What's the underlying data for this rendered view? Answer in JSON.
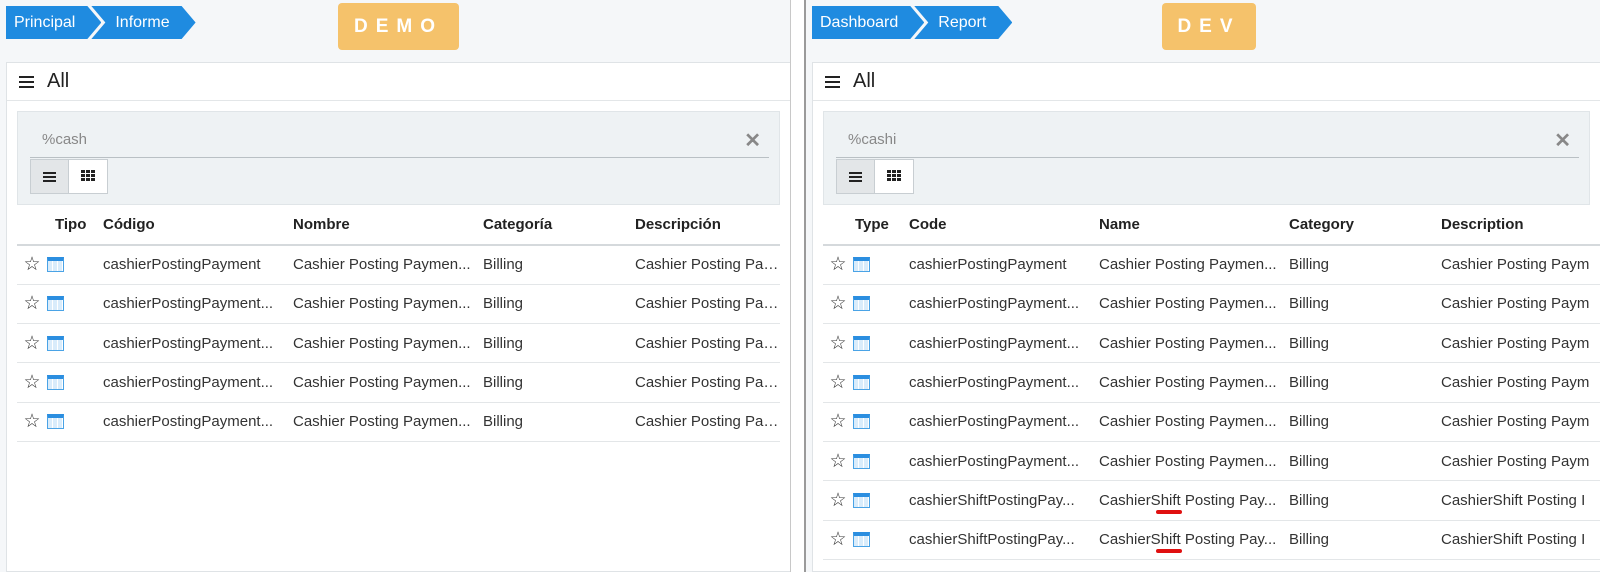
{
  "left": {
    "breadcrumbs": [
      "Principal",
      "Informe"
    ],
    "badge": "DEMO",
    "header_title": "All",
    "search": {
      "value": "%cash",
      "placeholder": ""
    },
    "columns": {
      "type": "Tipo",
      "code": "Código",
      "name": "Nombre",
      "category": "Categoría",
      "description": "Descripción"
    },
    "rows": [
      {
        "code": "cashierPostingPayment",
        "name": "Cashier Posting Paymen...",
        "category": "Billing",
        "description": "Cashier Posting Paym"
      },
      {
        "code": "cashierPostingPayment...",
        "name": "Cashier Posting Paymen...",
        "category": "Billing",
        "description": "Cashier Posting Paym"
      },
      {
        "code": "cashierPostingPayment...",
        "name": "Cashier Posting Paymen...",
        "category": "Billing",
        "description": "Cashier Posting Paym"
      },
      {
        "code": "cashierPostingPayment...",
        "name": "Cashier Posting Paymen...",
        "category": "Billing",
        "description": "Cashier Posting Paym"
      },
      {
        "code": "cashierPostingPayment...",
        "name": "Cashier Posting Paymen...",
        "category": "Billing",
        "description": "Cashier Posting Paym"
      }
    ]
  },
  "right": {
    "breadcrumbs": [
      "Dashboard",
      "Report"
    ],
    "badge": "DEV",
    "header_title": "All",
    "search": {
      "value": "%cashi",
      "placeholder": ""
    },
    "columns": {
      "type": "Type",
      "code": "Code",
      "name": "Name",
      "category": "Category",
      "description": "Description"
    },
    "rows": [
      {
        "code": "cashierPostingPayment",
        "name": "Cashier Posting Paymen...",
        "category": "Billing",
        "description": "Cashier Posting Paym"
      },
      {
        "code": "cashierPostingPayment...",
        "name": "Cashier Posting Paymen...",
        "category": "Billing",
        "description": "Cashier Posting Paym"
      },
      {
        "code": "cashierPostingPayment...",
        "name": "Cashier Posting Paymen...",
        "category": "Billing",
        "description": "Cashier Posting Paym"
      },
      {
        "code": "cashierPostingPayment...",
        "name": "Cashier Posting Paymen...",
        "category": "Billing",
        "description": "Cashier Posting Paym"
      },
      {
        "code": "cashierPostingPayment...",
        "name": "Cashier Posting Paymen...",
        "category": "Billing",
        "description": "Cashier Posting Paym"
      },
      {
        "code": "cashierPostingPayment...",
        "name": "Cashier Posting Paymen...",
        "category": "Billing",
        "description": "Cashier Posting Paym"
      },
      {
        "code": "cashierShiftPostingPay...",
        "name": "CashierShift Posting Pay...",
        "category": "Billing",
        "description": "CashierShift Posting I"
      },
      {
        "code": "cashierShiftPostingPay...",
        "name": "CashierShift Posting Pay...",
        "category": "Billing",
        "description": "CashierShift Posting I"
      }
    ]
  },
  "icons": {
    "star": "star-outline-icon",
    "type": "table-icon",
    "menu": "hamburger-icon",
    "clear": "close-icon",
    "list": "list-view-icon",
    "grid": "grid-view-icon"
  },
  "colors": {
    "accent": "#1f8be0",
    "badge": "#f5c26b",
    "annotation": "#e01010"
  }
}
